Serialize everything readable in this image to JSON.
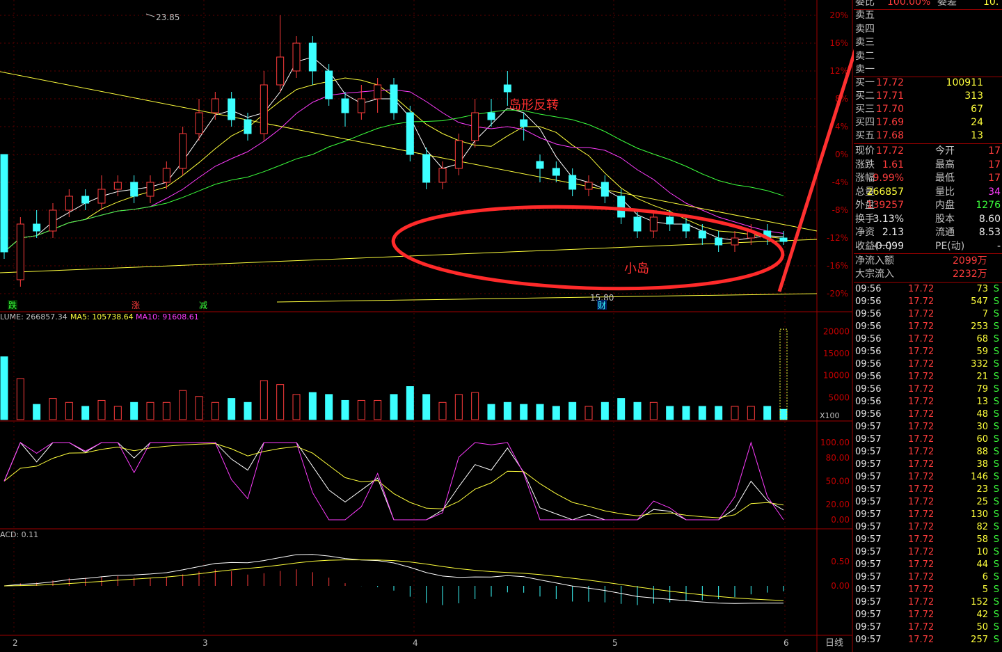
{
  "price_axis": [
    "20%",
    "16%",
    "12%",
    "8%",
    "4%",
    "0%",
    "-4%",
    "-8%",
    "-12%",
    "-16%",
    "-20%"
  ],
  "annotations": {
    "high": "23.85",
    "low": "15.80",
    "title": "岛形反转",
    "island": "小岛",
    "marker_die": "跌",
    "marker_zhang": "涨",
    "marker_jian": "减",
    "marker_cai": "财"
  },
  "volume": {
    "legend_vol": "LUME: 266857.34",
    "legend_ma5": "MA5: 105738.64",
    "legend_ma10": "MA10: 91608.61",
    "axis": [
      "20000",
      "15000",
      "10000",
      "5000"
    ],
    "unit": "X100"
  },
  "kdj": {
    "axis": [
      "100.00",
      "80.00",
      "50.00",
      "20.00",
      "0.00"
    ]
  },
  "macd": {
    "legend": "ACD: 0.11",
    "axis": [
      "0.50",
      "0.00"
    ]
  },
  "time_axis": [
    "2",
    "3",
    "4",
    "5",
    "6"
  ],
  "period": "日线",
  "colors": {
    "up": "#ff3c3c",
    "down": "#3cffff",
    "grid": "#a00000",
    "arrow": "#ff3030"
  },
  "quote": {
    "header_left": "委比",
    "header_val": "100.00%",
    "header_right": "委差",
    "header_val2": "10.",
    "sell": [
      {
        "label": "卖五"
      },
      {
        "label": "卖四"
      },
      {
        "label": "卖三"
      },
      {
        "label": "卖二"
      },
      {
        "label": "卖一"
      }
    ],
    "buy": [
      {
        "label": "买一",
        "price": "17.72",
        "vol": "100911"
      },
      {
        "label": "买二",
        "price": "17.71",
        "vol": "313"
      },
      {
        "label": "买三",
        "price": "17.70",
        "vol": "67"
      },
      {
        "label": "买四",
        "price": "17.69",
        "vol": "24"
      },
      {
        "label": "买五",
        "price": "17.68",
        "vol": "13"
      }
    ],
    "stats": {
      "xianjia_l": "现价",
      "xianjia": "17.72",
      "jinkai_l": "今开",
      "jinkai": "17",
      "zhangdie_l": "涨跌",
      "zhangdie": "1.61",
      "zuigao_l": "最高",
      "zuigao": "17",
      "zhangfu_l": "涨幅",
      "zhangfu": "9.99%",
      "zuidi_l": "最低",
      "zuidi": "17",
      "zongliang_l": "总量",
      "zongliang": "266857",
      "liangbi_l": "量比",
      "liangbi": "34",
      "waipan_l": "外盘",
      "waipan": "139257",
      "neipan_l": "内盘",
      "neipan": "1276",
      "huanshou_l": "换手",
      "huanshou": "3.13%",
      "guben_l": "股本",
      "guben": "8.60",
      "jingzi_l": "净资",
      "jingzi": "2.13",
      "liutong_l": "流通",
      "liutong": "8.53",
      "shouyi_l": "收益(一)",
      "shouyi": "-0.099",
      "pe_l": "PE(动)",
      "pe": "-"
    },
    "flow": {
      "net_l": "净流入额",
      "net": "2099万",
      "big_l": "大宗流入",
      "big": "2232万"
    },
    "ticks": [
      [
        "09:56",
        "17.72",
        "73",
        "S"
      ],
      [
        "09:56",
        "17.72",
        "547",
        "S"
      ],
      [
        "09:56",
        "17.72",
        "7",
        "S"
      ],
      [
        "09:56",
        "17.72",
        "253",
        "S"
      ],
      [
        "09:56",
        "17.72",
        "68",
        "S"
      ],
      [
        "09:56",
        "17.72",
        "59",
        "S"
      ],
      [
        "09:56",
        "17.72",
        "332",
        "S"
      ],
      [
        "09:56",
        "17.72",
        "21",
        "S"
      ],
      [
        "09:56",
        "17.72",
        "79",
        "S"
      ],
      [
        "09:56",
        "17.72",
        "13",
        "S"
      ],
      [
        "09:56",
        "17.72",
        "48",
        "S"
      ],
      [
        "09:57",
        "17.72",
        "30",
        "S"
      ],
      [
        "09:57",
        "17.72",
        "60",
        "S"
      ],
      [
        "09:57",
        "17.72",
        "88",
        "S"
      ],
      [
        "09:57",
        "17.72",
        "38",
        "S"
      ],
      [
        "09:57",
        "17.72",
        "146",
        "S"
      ],
      [
        "09:57",
        "17.72",
        "23",
        "S"
      ],
      [
        "09:57",
        "17.72",
        "25",
        "S"
      ],
      [
        "09:57",
        "17.72",
        "130",
        "S"
      ],
      [
        "09:57",
        "17.72",
        "82",
        "S"
      ],
      [
        "09:57",
        "17.72",
        "58",
        "S"
      ],
      [
        "09:57",
        "17.72",
        "10",
        "S"
      ],
      [
        "09:57",
        "17.72",
        "44",
        "S"
      ],
      [
        "09:57",
        "17.72",
        "6",
        "S"
      ],
      [
        "09:57",
        "17.72",
        "5",
        "S"
      ],
      [
        "09:57",
        "17.72",
        "152",
        "S"
      ],
      [
        "09:57",
        "17.72",
        "42",
        "S"
      ],
      [
        "09:57",
        "17.72",
        "50",
        "S"
      ],
      [
        "09:57",
        "17.72",
        "257",
        "S"
      ]
    ]
  },
  "candles": [
    {
      "o": 0,
      "c": -14,
      "h": 0,
      "l": -15
    },
    {
      "o": -18,
      "c": -10,
      "h": -9,
      "l": -19
    },
    {
      "o": -10,
      "c": -11,
      "h": -8,
      "l": -12
    },
    {
      "o": -11,
      "c": -8,
      "h": -7,
      "l": -12
    },
    {
      "o": -8,
      "c": -6,
      "h": -5,
      "l": -9
    },
    {
      "o": -6,
      "c": -7,
      "h": -5,
      "l": -8
    },
    {
      "o": -7,
      "c": -5,
      "h": -3,
      "l": -8
    },
    {
      "o": -5,
      "c": -4,
      "h": -3,
      "l": -6
    },
    {
      "o": -4,
      "c": -6,
      "h": -3,
      "l": -7
    },
    {
      "o": -6,
      "c": -4,
      "h": -3,
      "l": -7
    },
    {
      "o": -4,
      "c": -2,
      "h": -1,
      "l": -5
    },
    {
      "o": -2,
      "c": 3,
      "h": 4,
      "l": -3
    },
    {
      "o": 3,
      "c": 6,
      "h": 8,
      "l": 2
    },
    {
      "o": 6,
      "c": 8,
      "h": 9,
      "l": 5
    },
    {
      "o": 8,
      "c": 5,
      "h": 9,
      "l": 4
    },
    {
      "o": 5,
      "c": 3,
      "h": 6,
      "l": 2
    },
    {
      "o": 3,
      "c": 10,
      "h": 12,
      "l": 2
    },
    {
      "o": 10,
      "c": 14,
      "h": 20,
      "l": 9
    },
    {
      "o": 12,
      "c": 16,
      "h": 17,
      "l": 11
    },
    {
      "o": 16,
      "c": 12,
      "h": 17,
      "l": 10
    },
    {
      "o": 12,
      "c": 8,
      "h": 13,
      "l": 7
    },
    {
      "o": 8,
      "c": 6,
      "h": 9,
      "l": 4
    },
    {
      "o": 6,
      "c": 8,
      "h": 10,
      "l": 5
    },
    {
      "o": 8,
      "c": 10,
      "h": 11,
      "l": 6
    },
    {
      "o": 10,
      "c": 6,
      "h": 11,
      "l": 5
    },
    {
      "o": 6,
      "c": 0,
      "h": 7,
      "l": -1
    },
    {
      "o": 0,
      "c": -4,
      "h": 1,
      "l": -5
    },
    {
      "o": -4,
      "c": -2,
      "h": -1,
      "l": -5
    },
    {
      "o": -2,
      "c": 2,
      "h": 3,
      "l": -3
    },
    {
      "o": 2,
      "c": 6,
      "h": 8,
      "l": 1
    },
    {
      "o": 6,
      "c": 5,
      "h": 8,
      "l": 4
    },
    {
      "o": 10,
      "c": 9,
      "h": 12,
      "l": 7
    },
    {
      "o": 5,
      "c": 4,
      "h": 6,
      "l": 2
    },
    {
      "o": -1,
      "c": -2,
      "h": 0,
      "l": -4
    },
    {
      "o": -2,
      "c": -3,
      "h": -1,
      "l": -4
    },
    {
      "o": -3,
      "c": -5,
      "h": -2,
      "l": -6
    },
    {
      "o": -5,
      "c": -4,
      "h": -3,
      "l": -6
    },
    {
      "o": -4,
      "c": -6,
      "h": -3,
      "l": -7
    },
    {
      "o": -6,
      "c": -9,
      "h": -5,
      "l": -10
    },
    {
      "o": -9,
      "c": -11,
      "h": -8,
      "l": -12
    },
    {
      "o": -11,
      "c": -9,
      "h": -8,
      "l": -12
    },
    {
      "o": -9,
      "c": -10,
      "h": -8,
      "l": -11
    },
    {
      "o": -10,
      "c": -11,
      "h": -9,
      "l": -12
    },
    {
      "o": -11,
      "c": -12,
      "h": -10,
      "l": -13
    },
    {
      "o": -12,
      "c": -13,
      "h": -11,
      "l": -14
    },
    {
      "o": -13,
      "c": -12,
      "h": -11,
      "l": -14
    },
    {
      "o": -12,
      "c": -11,
      "h": -10,
      "l": -13
    },
    {
      "o": -11,
      "c": -12,
      "h": -10,
      "l": -13
    },
    {
      "o": -12,
      "c": -12.5,
      "h": -11,
      "l": -13
    }
  ]
}
